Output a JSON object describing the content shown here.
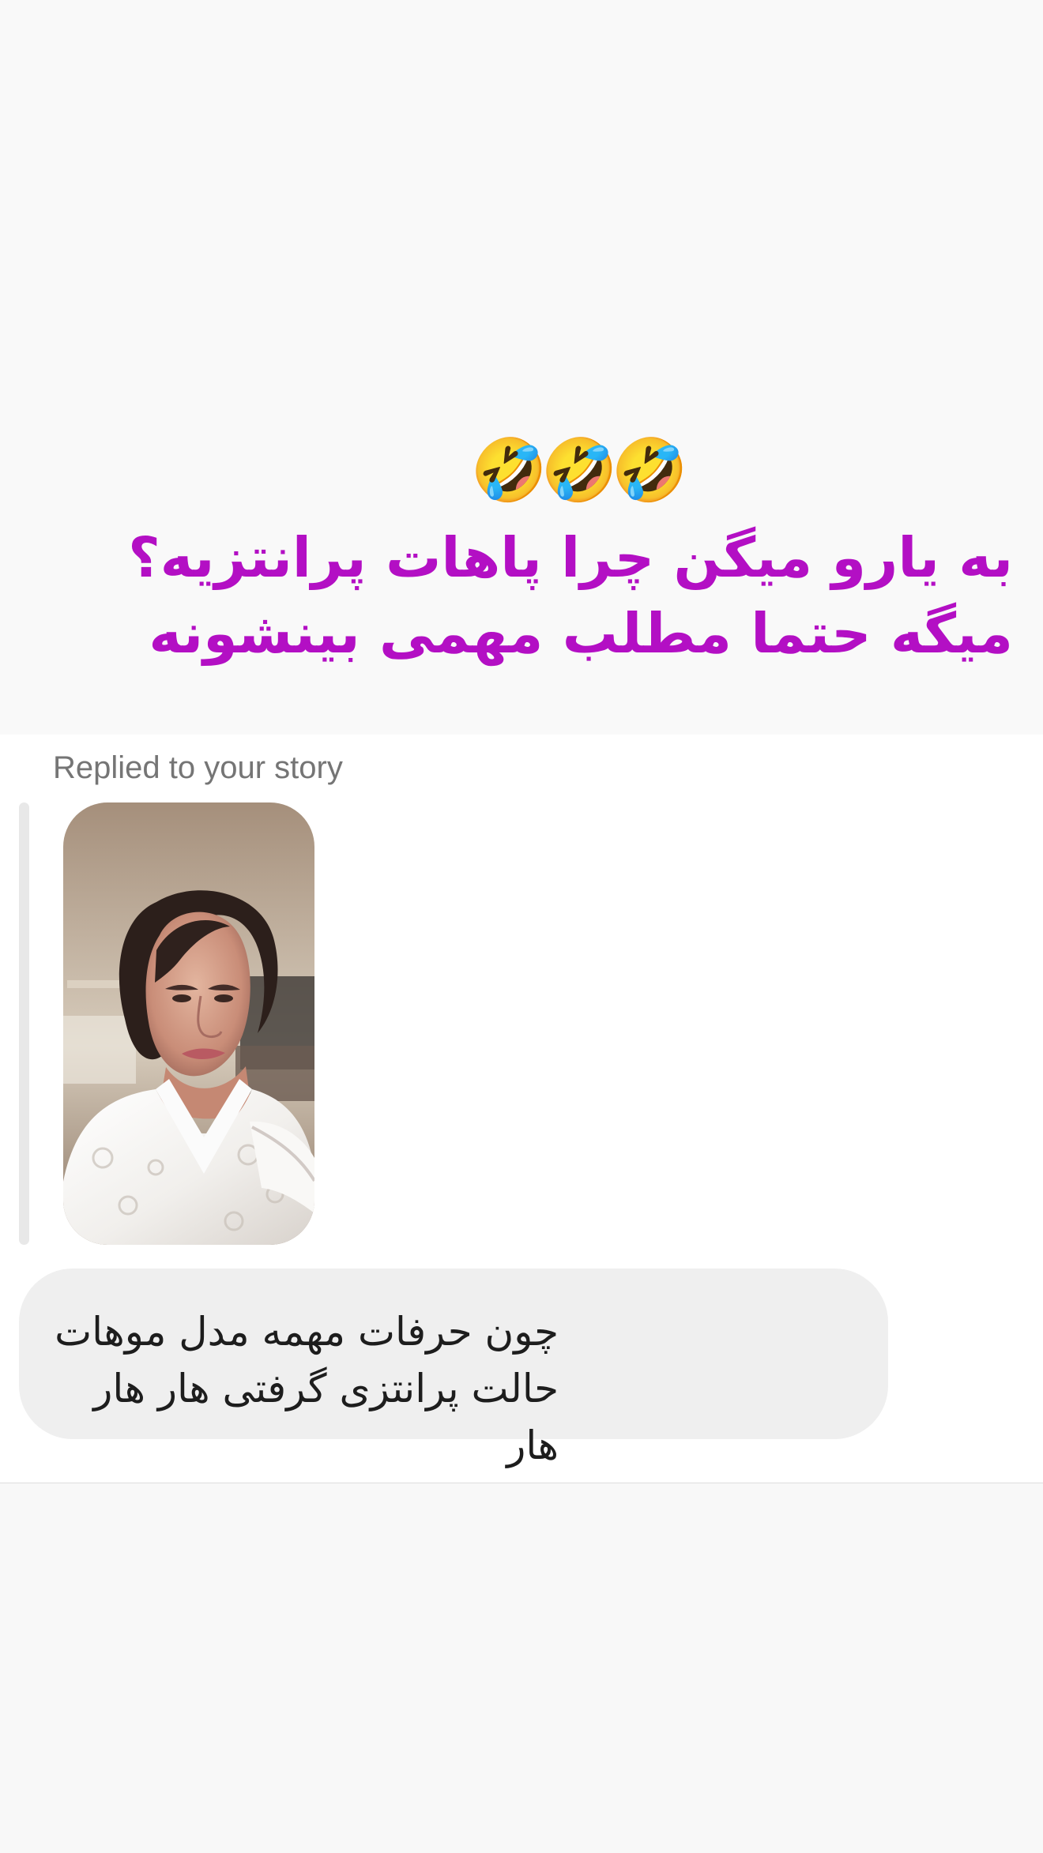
{
  "story_caption": {
    "emoji": "🤣🤣🤣",
    "line1": "به یارو میگن چرا پاهات پرانتزیه؟",
    "line2": "میگه حتما مطلب مهمی بینشونه",
    "color": "#b30fc4"
  },
  "reply": {
    "label": "Replied to your story"
  },
  "story_thumbnail": {
    "description_icon": "story-photo"
  },
  "message": {
    "text": "چون حرفات مهمه مدل موهات حالت پرانتزی گرفتی هار هار هار"
  },
  "colors": {
    "bubble": "#efefef",
    "reply_bar": "#e8e8e8",
    "label": "#757575"
  }
}
